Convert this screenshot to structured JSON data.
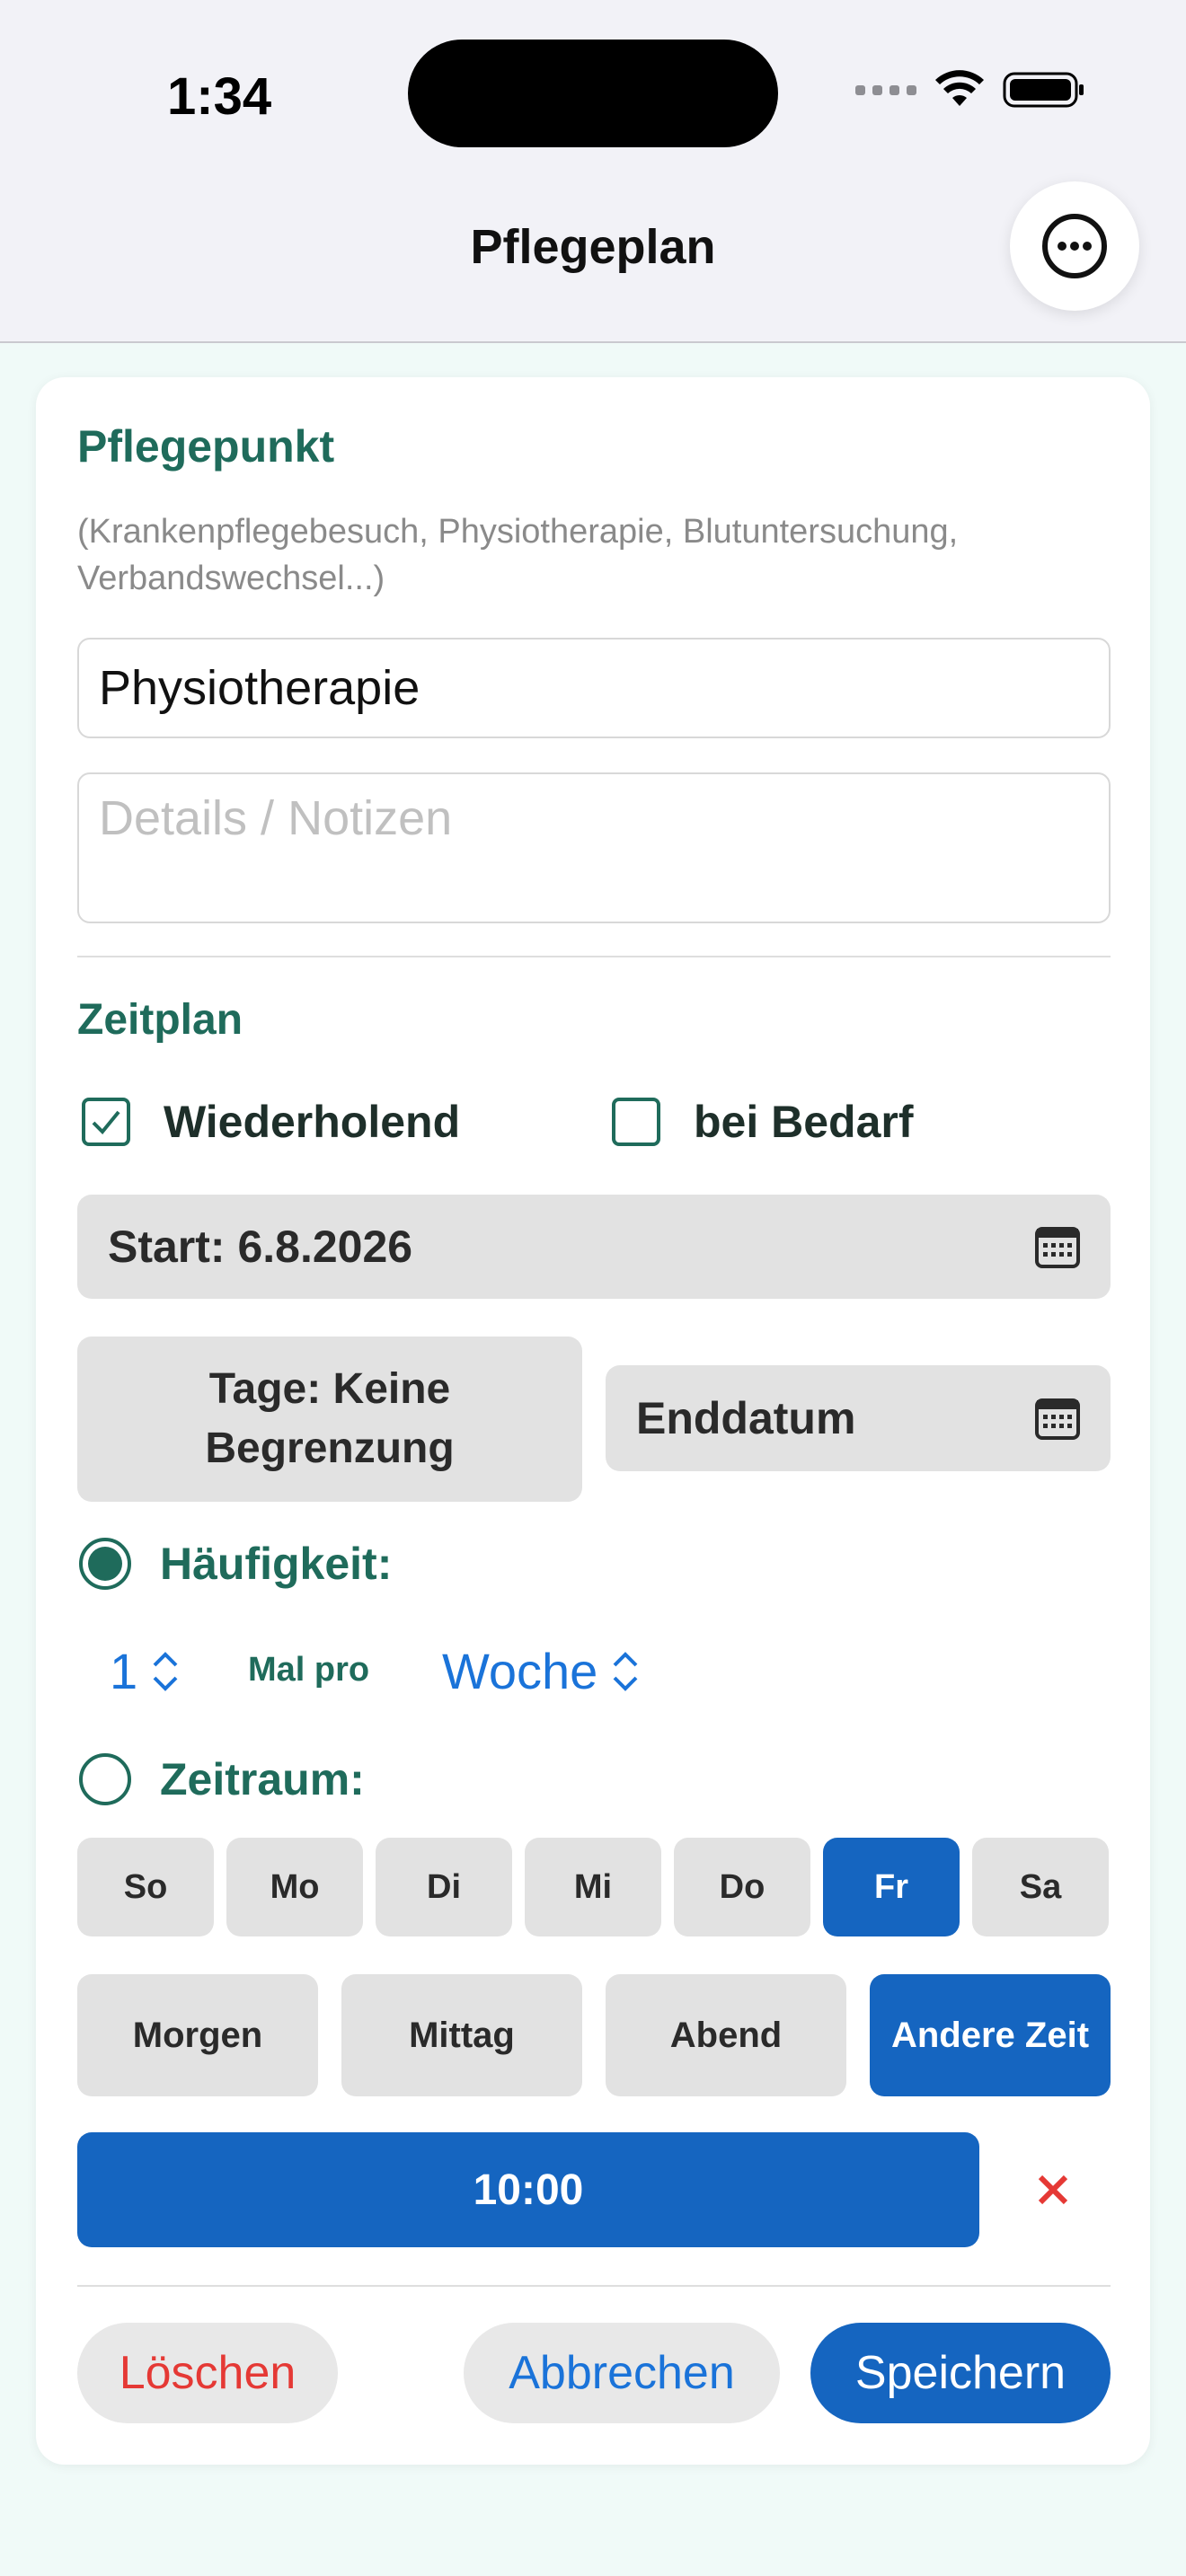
{
  "status_bar": {
    "time": "1:34"
  },
  "header": {
    "title": "Pflegeplan",
    "menu_icon": "ellipsis-circle-icon"
  },
  "care_item": {
    "section_title": "Pflegepunkt",
    "hint": "(Krankenpflegebesuch, Physiotherapie, Blutuntersuchung, Verbandswechsel...)",
    "name_value": "Physiotherapie",
    "details_placeholder": "Details / Notizen"
  },
  "schedule": {
    "section_title": "Zeitplan",
    "recurring_label": "Wiederholend",
    "recurring_checked": true,
    "as_needed_label": "bei Bedarf",
    "as_needed_checked": false,
    "start_label": "Start: 6.8.2026",
    "days_label_line1": "Tage: Keine",
    "days_label_line2": "Begrenzung",
    "end_date_label": "Enddatum",
    "frequency_label": "Häufigkeit:",
    "frequency_selected": true,
    "frequency_count": "1",
    "times_per_label": "Mal pro",
    "frequency_unit": "Woche",
    "period_label": "Zeitraum:",
    "period_selected": false,
    "weekdays": [
      {
        "label": "So",
        "active": false
      },
      {
        "label": "Mo",
        "active": false
      },
      {
        "label": "Di",
        "active": false
      },
      {
        "label": "Mi",
        "active": false
      },
      {
        "label": "Do",
        "active": false
      },
      {
        "label": "Fr",
        "active": true
      },
      {
        "label": "Sa",
        "active": false
      }
    ],
    "time_slots": [
      {
        "label": "Morgen",
        "active": false
      },
      {
        "label": "Mittag",
        "active": false
      },
      {
        "label": "Abend",
        "active": false
      },
      {
        "label": "Andere Zeit",
        "active": true
      }
    ],
    "selected_time": "10:00"
  },
  "actions": {
    "delete_label": "Löschen",
    "cancel_label": "Abbrechen",
    "save_label": "Speichern"
  },
  "colors": {
    "accent_green": "#1f6b5b",
    "primary_blue": "#1565c0",
    "link_blue": "#1a73d9",
    "danger_red": "#e53935"
  }
}
